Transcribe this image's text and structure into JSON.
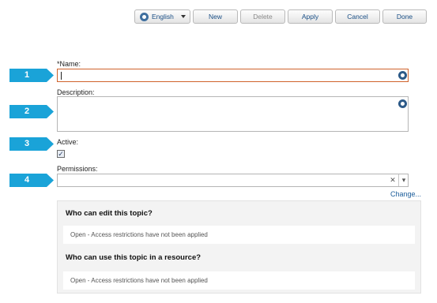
{
  "toolbar": {
    "language_label": "English",
    "new_label": "New",
    "delete_label": "Delete",
    "apply_label": "Apply",
    "cancel_label": "Cancel",
    "done_label": "Done"
  },
  "steps": [
    "1",
    "2",
    "3",
    "4"
  ],
  "form": {
    "name_label": "*Name:",
    "name_value": "",
    "description_label": "Description:",
    "description_value": "",
    "active_label": "Active:",
    "active_checked": true,
    "permissions_label": "Permissions:",
    "permissions_value": "",
    "change_link": "Change..."
  },
  "permissions_panel": {
    "edit_heading": "Who can edit this topic?",
    "edit_status": "Open - Access restrictions have not been applied",
    "use_heading": "Who can use this topic in a resource?",
    "use_status": "Open - Access restrictions have not been applied"
  },
  "colors": {
    "step_marker": "#1aa3d8",
    "focus_border": "#d0632c",
    "link": "#1a5c9a"
  },
  "icons": {
    "language": "globe-icon",
    "translate_field": "translate-icon",
    "clear": "clear-icon",
    "dropdown": "chevron-down-icon"
  }
}
